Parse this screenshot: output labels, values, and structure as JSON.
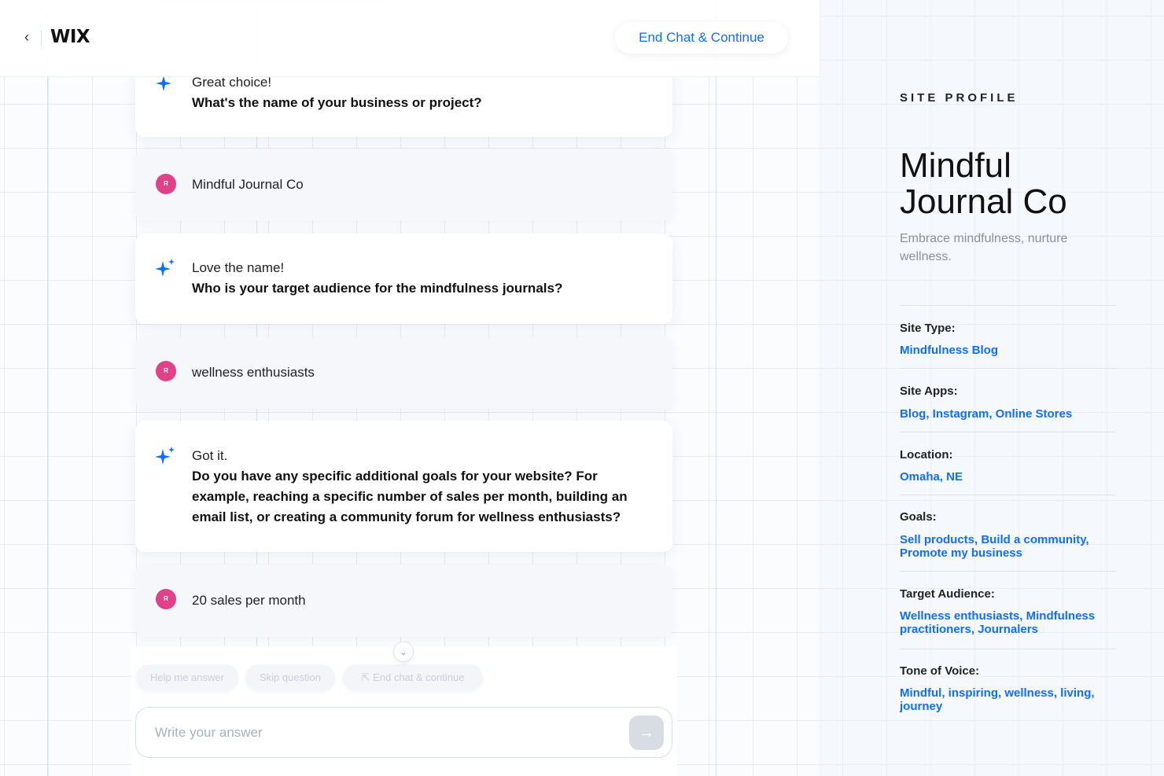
{
  "header": {
    "back_icon": "chevron-left-icon",
    "logo": "WIX",
    "end_chat_label": "End Chat & Continue"
  },
  "chat": {
    "messages": [
      {
        "role": "ai",
        "lead": "Great choice!",
        "question": "What's the name of your business or project?"
      },
      {
        "role": "user",
        "avatar_initial": "R",
        "text": "Mindful Journal Co"
      },
      {
        "role": "ai",
        "lead": "Love the name!",
        "question": "Who is your target audience for the mindfulness journals?"
      },
      {
        "role": "user",
        "avatar_initial": "R",
        "text": "wellness enthusiasts"
      },
      {
        "role": "ai",
        "lead": "Got it.",
        "question": "Do you have any specific additional goals for your website? For example, reaching a specific number of sales per month, building an email list, or creating a community forum for wellness enthusiasts?"
      },
      {
        "role": "user",
        "avatar_initial": "R",
        "text": "20 sales per month"
      }
    ],
    "chips": {
      "help": "Help me answer",
      "skip": "Skip question",
      "end": "End chat & continue"
    },
    "input_placeholder": "Write your answer",
    "accent_color": "#116dff",
    "user_avatar_color": "#e0428a"
  },
  "profile": {
    "section_label": "SITE PROFILE",
    "name": "Mindful Journal Co",
    "tagline": "Embrace mindfulness, nurture wellness.",
    "fields": [
      {
        "label": "Site Type:",
        "value": "Mindfulness Blog"
      },
      {
        "label": "Site Apps:",
        "value": "Blog, Instagram, Online Stores"
      },
      {
        "label": "Location:",
        "value": "Omaha, NE"
      },
      {
        "label": "Goals:",
        "value": "Sell products, Build a community, Promote my business"
      },
      {
        "label": "Target Audience:",
        "value": "Wellness enthusiasts, Mindfulness practitioners, Journalers"
      },
      {
        "label": "Tone of Voice:",
        "value": "Mindful, inspiring, wellness, living, journey"
      }
    ]
  }
}
